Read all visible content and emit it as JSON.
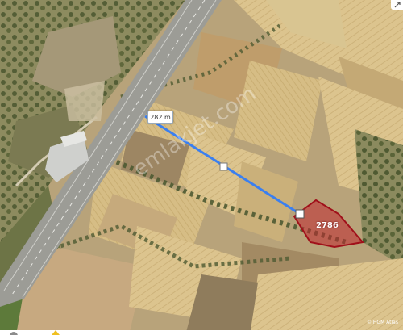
{
  "map": {
    "measurement": {
      "distance_label": "282 m",
      "line_color": "#3a7ff0"
    },
    "parcel": {
      "label": "2786",
      "fill_color": "#c0282f",
      "stroke_color": "#a0101a"
    },
    "watermark": "emlakjet.com",
    "attribution": "© HGM Atlas"
  },
  "colors": {
    "road": "#9a9a94",
    "field_light": "#d8c088",
    "field_mid": "#c9ad78",
    "field_dark": "#a18a62",
    "vegetation": "#5a6a3c"
  }
}
